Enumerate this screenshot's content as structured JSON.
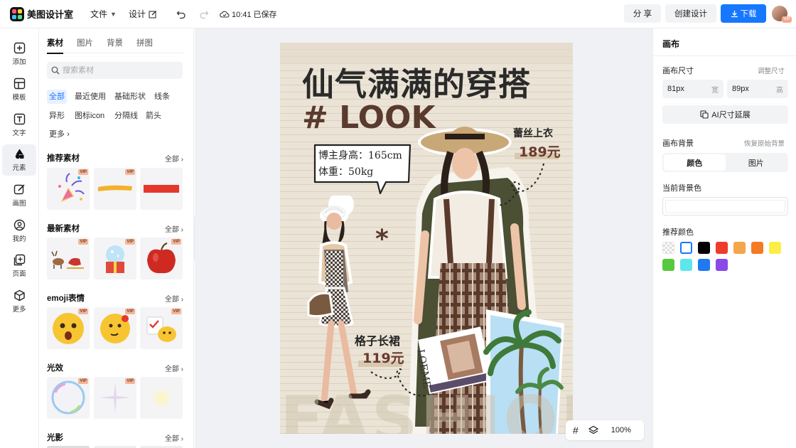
{
  "app": {
    "name": "美图设计室"
  },
  "topbar": {
    "file_menu": "文件",
    "design_menu": "设计",
    "save_status": "10:41 已保存",
    "share_label": "分 享",
    "create_label": "创建设计",
    "download_label": "下载",
    "avatar_badge": "VIP"
  },
  "rail": {
    "items": [
      {
        "label": "添加",
        "icon": "plus-square-icon"
      },
      {
        "label": "模板",
        "icon": "template-icon"
      },
      {
        "label": "文字",
        "icon": "text-icon"
      },
      {
        "label": "元素",
        "icon": "shapes-icon"
      },
      {
        "label": "画图",
        "icon": "draw-icon"
      },
      {
        "label": "我的",
        "icon": "user-icon"
      },
      {
        "label": "页面",
        "icon": "page-add-icon"
      },
      {
        "label": "更多",
        "icon": "cube-icon"
      }
    ],
    "active_index": 3
  },
  "panel": {
    "tabs": [
      "素材",
      "图片",
      "背景",
      "拼图"
    ],
    "active_tab": 0,
    "search_placeholder": "搜索素材",
    "chips": [
      "全部",
      "最近使用",
      "基础形状",
      "线条",
      "异形",
      "图标icon",
      "分隔线",
      "箭头",
      "更多"
    ],
    "sections": [
      {
        "title": "推荐素材",
        "more": "全部"
      },
      {
        "title": "最新素材",
        "more": "全部"
      },
      {
        "title": "emoji表情",
        "more": "全部"
      },
      {
        "title": "光效",
        "more": "全部"
      },
      {
        "title": "光影",
        "more": "全部"
      }
    ],
    "vip_badge": "VIP"
  },
  "canvas": {
    "headline": "仙气满满的穿搭",
    "subhead": "# LOOK",
    "bubble_line1": "博主身高：165cm",
    "bubble_line2": "体重：50kg",
    "star": "*",
    "item1_name": "蕾丝上衣",
    "item1_price": "189元",
    "item2_name": "格子长裙",
    "item2_price": "119元",
    "magazine_text": "LOEME",
    "bg_text": "FASHION",
    "zoom": "100%"
  },
  "right_panel": {
    "title": "画布",
    "size_label": "画布尺寸",
    "size_link": "调整尺寸",
    "width_value": "81px",
    "width_unit": "宽",
    "height_value": "89px",
    "height_unit": "高",
    "ai_button": "AI尺寸延展",
    "bg_label": "画布背景",
    "bg_reset": "恢复原始背景",
    "seg_color": "颜色",
    "seg_image": "图片",
    "current_color_label": "当前背景色",
    "recommend_label": "推荐颜色",
    "swatches": [
      "transparent",
      "#ffffff",
      "#000000",
      "#ee3b2b",
      "#f5a54a",
      "#f47b24",
      "#fbef47",
      "#57c93e",
      "#5ee7ea",
      "#1f7af2",
      "#8a4ae8"
    ]
  }
}
